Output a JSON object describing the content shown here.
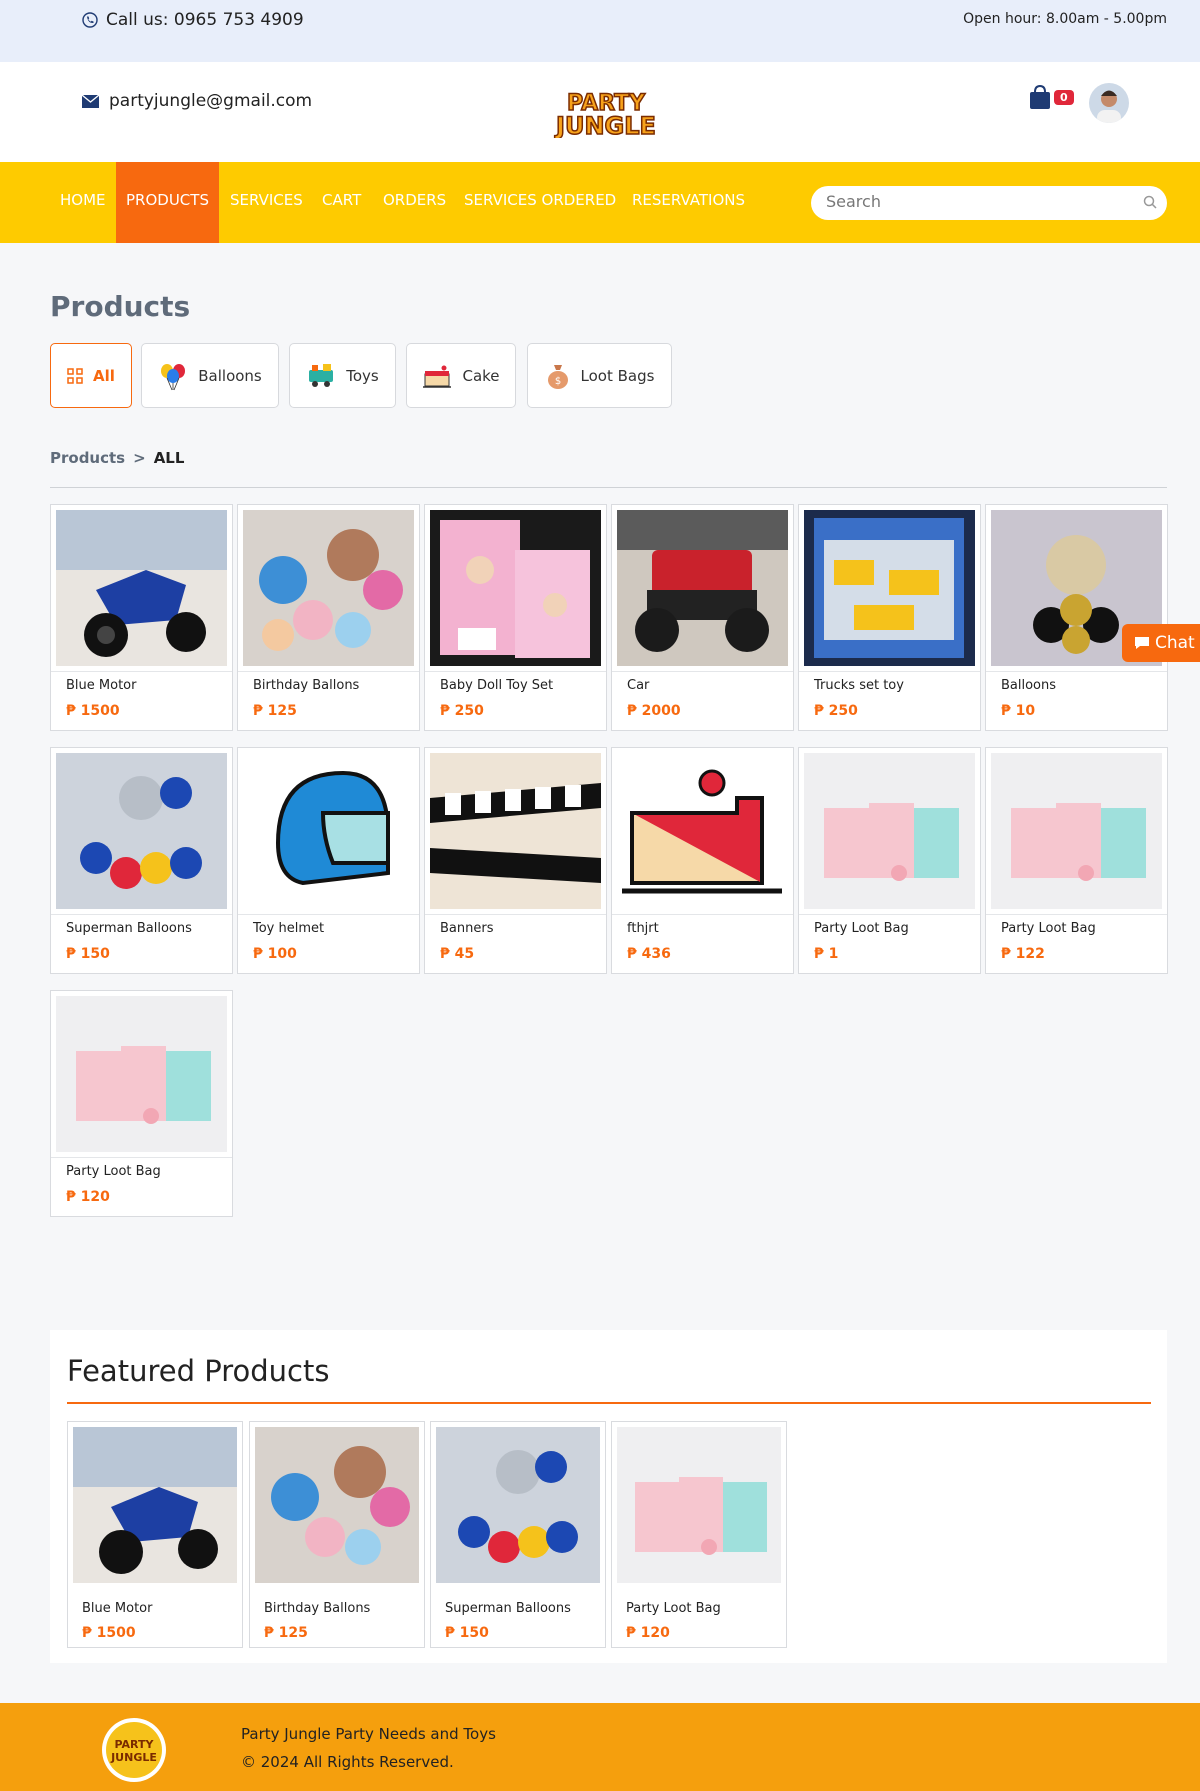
{
  "topbar": {
    "phone": "Call us: 0965 753 4909",
    "hours": "Open hour: 8.00am - 5.00pm"
  },
  "header": {
    "email": "partyjungle@gmail.com",
    "logo_text_1": "PARTY",
    "logo_text_2": "JUNGLE",
    "cart_count": "0"
  },
  "nav": {
    "items": [
      "HOME",
      "PRODUCTS",
      "SERVICES",
      "CART",
      "ORDERS",
      "SERVICES ORDERED",
      "RESERVATIONS"
    ],
    "active": "PRODUCTS",
    "search_placeholder": "Search"
  },
  "page_title": "Products",
  "categories": [
    "All",
    "Balloons",
    "Toys",
    "Cake",
    "Loot Bags"
  ],
  "breadcrumb": {
    "root": "Products",
    "sep": ">",
    "current": "ALL"
  },
  "products": [
    {
      "name": "Blue Motor",
      "price": "₱ 1500"
    },
    {
      "name": "Birthday Ballons",
      "price": "₱ 125"
    },
    {
      "name": "Baby Doll Toy Set",
      "price": "₱ 250"
    },
    {
      "name": "Car",
      "price": "₱ 2000"
    },
    {
      "name": "Trucks set toy",
      "price": "₱ 250"
    },
    {
      "name": "Balloons",
      "price": "₱ 10"
    },
    {
      "name": "Superman Balloons",
      "price": "₱ 150"
    },
    {
      "name": "Toy helmet",
      "price": "₱ 100"
    },
    {
      "name": "Banners",
      "price": "₱ 45"
    },
    {
      "name": "fthjrt",
      "price": "₱ 436"
    },
    {
      "name": "Party Loot Bag",
      "price": "₱ 1"
    },
    {
      "name": "Party Loot Bag",
      "price": "₱ 122"
    },
    {
      "name": "Party Loot Bag",
      "price": "₱ 120"
    }
  ],
  "chat_label": "Chat",
  "featured": {
    "title": "Featured Products",
    "items": [
      {
        "name": "Blue Motor",
        "price": "₱ 1500"
      },
      {
        "name": "Birthday Ballons",
        "price": "₱ 125"
      },
      {
        "name": "Superman Balloons",
        "price": "₱ 150"
      },
      {
        "name": "Party Loot Bag",
        "price": "₱ 120"
      }
    ]
  },
  "footer": {
    "line1": "Party Jungle Party Needs and Toys",
    "line2": "© 2024 All Rights Reserved."
  },
  "colors": {
    "accent": "#f7690f",
    "nav_bg": "#fecb00",
    "footer_bg": "#f59f0d",
    "topbar_bg": "#e8eefa"
  }
}
